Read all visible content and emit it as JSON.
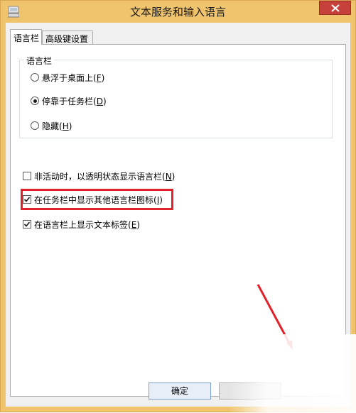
{
  "window": {
    "title": "文本服务和输入语言"
  },
  "tabs": [
    {
      "label": "语言栏",
      "active": true
    },
    {
      "label": "高级键设置",
      "active": false
    }
  ],
  "language_bar_group": {
    "title": "语言栏",
    "options": [
      {
        "text": "悬浮于桌面上(",
        "key": "F",
        "tail": ")",
        "selected": false
      },
      {
        "text": "停靠于任务栏(",
        "key": "D",
        "tail": ")",
        "selected": true
      },
      {
        "text": "隐藏(",
        "key": "H",
        "tail": ")",
        "selected": false
      }
    ]
  },
  "checkboxes": [
    {
      "text": "非活动时，以透明状态显示语言栏(",
      "key": "N",
      "tail": ")",
      "checked": false
    },
    {
      "text": "在任务栏中显示其他语言栏图标(",
      "key": "I",
      "tail": ")",
      "checked": true
    },
    {
      "text": "在语言栏上显示文本标签(",
      "key": "E",
      "tail": ")",
      "checked": true
    }
  ],
  "buttons": {
    "ok": "确定"
  },
  "colors": {
    "title_bar": "#f0c46d",
    "close": "#c7413b",
    "highlight": "#e0232a"
  }
}
